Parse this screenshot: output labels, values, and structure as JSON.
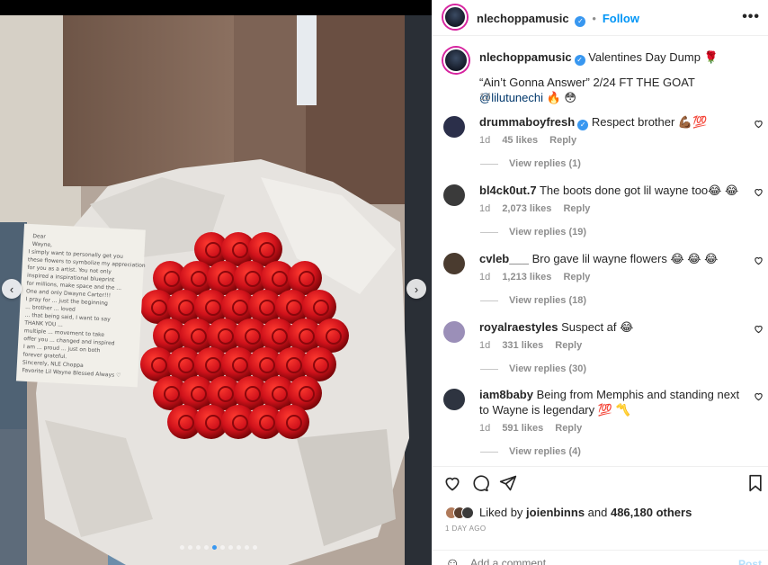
{
  "post": {
    "author": "nlechoppamusic",
    "follow_label": "Follow",
    "more_label": "•••",
    "caption_line1": "Valentines Day Dump 🌹",
    "caption_line2_pre": "“Ain’t Gonna Answer” 2/24 FT THE GOAT ",
    "caption_mention": "@lilutunechi",
    "caption_line2_post": " 🔥 😳",
    "caption_age": "1d"
  },
  "note": {
    "text": "Dear\nWayne,\nI simply want to personally get you\nthese flowers to symbolize my appreciation\nfor you as a artist. You not only\ninspired a inspirational blueprint\nfor millions, make space and the ...\nOne and only Dwayne Carter!!!\nI pray for ... just the beginning\n... brother ... loved\n... that being said, I want to say\nTHANK YOU ...\nmultiple ... movement to take\noffer you ... changed and inspired\nI am ... proud ... just on both\nforever grateful.\nSincerely, NLE Choppa\nFavorite Lil Wayne Blessed Always ♡"
  },
  "comments": [
    {
      "user": "drummaboyfresh",
      "verified": true,
      "text": "Respect brother 💪🏾💯",
      "age": "1d",
      "likes": "45 likes",
      "reply": "Reply",
      "replies": "View replies (1)",
      "avatar_color": "#2b2f4a"
    },
    {
      "user": "bl4ck0ut.7",
      "verified": false,
      "text": "The boots done got lil wayne too😂 😂",
      "age": "1d",
      "likes": "2,073 likes",
      "reply": "Reply",
      "replies": "View replies (19)",
      "avatar_color": "#3a3a3a"
    },
    {
      "user": "cvleb___",
      "verified": false,
      "text": "Bro gave lil wayne flowers 😂 😂 😂",
      "age": "1d",
      "likes": "1,213 likes",
      "reply": "Reply",
      "replies": "View replies (18)",
      "avatar_color": "#4a3b2f"
    },
    {
      "user": "royalraestyles",
      "verified": false,
      "text": "Suspect af 😂",
      "age": "1d",
      "likes": "331 likes",
      "reply": "Reply",
      "replies": "View replies (30)",
      "avatar_color": "#9b8fb8"
    },
    {
      "user": "iam8baby",
      "verified": false,
      "text": "Being from Memphis and standing next to Wayne is legendary 💯 〽️",
      "age": "1d",
      "likes": "591 likes",
      "reply": "Reply",
      "replies": "View replies (4)",
      "avatar_color": "#2e3440"
    }
  ],
  "footer": {
    "liked_by_pre": "Liked by ",
    "liked_by_user": "joienbinns",
    "liked_by_mid": " and ",
    "liked_by_count": "486,180 others",
    "time_ago": "1 DAY AGO",
    "comment_placeholder": "Add a comment...",
    "post_label": "Post"
  },
  "media": {
    "carousel_count": 10,
    "carousel_active": 4
  }
}
